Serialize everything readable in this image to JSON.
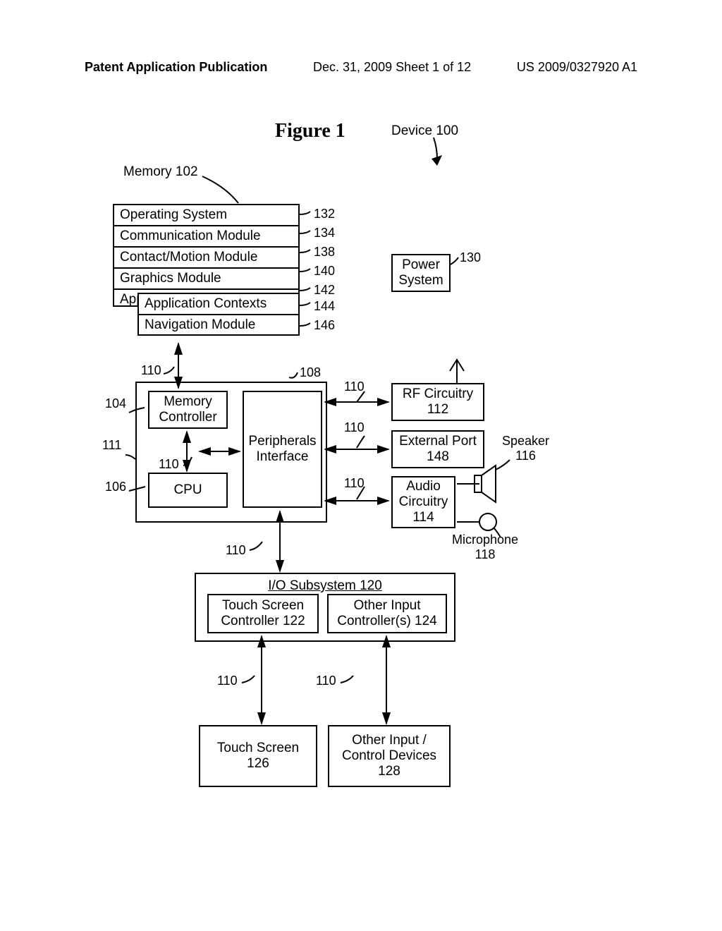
{
  "header": {
    "left": "Patent Application Publication",
    "center": "Dec. 31, 2009  Sheet 1 of 12",
    "right": "US 2009/0327920 A1"
  },
  "figure_title": "Figure 1",
  "labels": {
    "device": "Device 100",
    "memory_label": "Memory 102",
    "power_system": "Power\nSystem",
    "memory_controller": "Memory\nController",
    "peripherals_interface": "Peripherals\nInterface",
    "cpu": "CPU",
    "rf_circuitry": "RF Circuitry\n112",
    "external_port": "External Port\n148",
    "audio_circuitry": "Audio\nCircuitry\n114",
    "speaker": "Speaker\n116",
    "microphone": "Microphone\n118",
    "io_subsystem": "I/O Subsystem 120",
    "touch_screen_controller": "Touch Screen\nController 122",
    "other_input_controllers": "Other Input\nController(s) 124",
    "touch_screen": "Touch Screen\n126",
    "other_input_devices": "Other Input /\nControl Devices\n128"
  },
  "memory_rows": {
    "os": "Operating System",
    "comm": "Communication Module",
    "contact": "Contact/Motion Module",
    "graphics": "Graphics Module",
    "apps": "Application(s)"
  },
  "sub_rows": {
    "contexts": "Application Contexts",
    "nav": "Navigation Module"
  },
  "ref_nums": {
    "n132": "132",
    "n134": "134",
    "n138": "138",
    "n140": "140",
    "n142": "142",
    "n144": "144",
    "n146": "146",
    "n130": "130",
    "n108": "108",
    "n104": "104",
    "n111": "111",
    "n106": "106",
    "n110": "110"
  }
}
